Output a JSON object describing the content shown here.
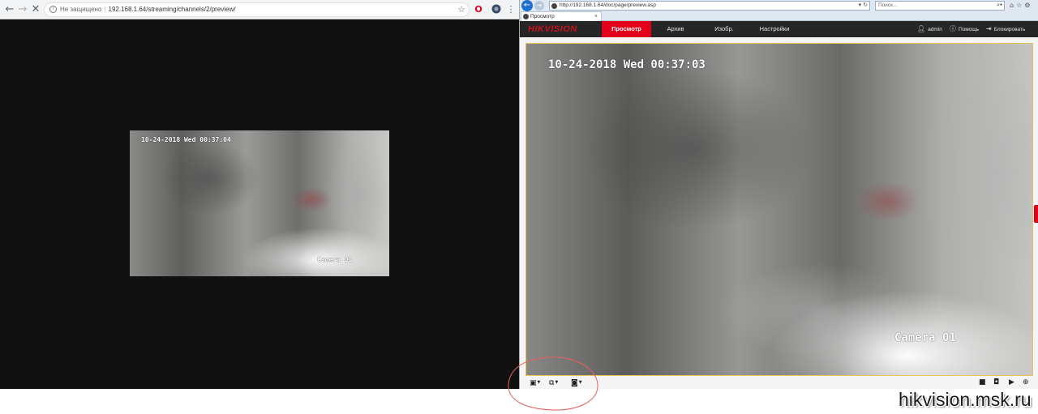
{
  "chrome": {
    "security_label": "Не защищено",
    "url": "192.168.1.64/streaming/channels/2/preview/",
    "back_icon": "arrow-left-icon",
    "forward_icon": "arrow-right-icon",
    "stop_icon": "close-icon"
  },
  "small_video": {
    "timestamp": "10-24-2018 Wed 00:37:04",
    "camera_name": "Camera 01"
  },
  "ie": {
    "url": "http://192.168.1.64/doc/page/preview.asp",
    "search_placeholder": "Поиск...",
    "tab_title": "Просмотр"
  },
  "hikvision": {
    "logo": "HIKVISION",
    "nav": [
      "Просмотр",
      "Архив",
      "Изобр.",
      "Настройки"
    ],
    "active_nav": "Просмотр",
    "user": "admin",
    "help": "Помощь",
    "lock": "Блокировать",
    "accent_color": "#e2001a"
  },
  "large_video": {
    "timestamp": "10-24-2018 Wed 00:37:03",
    "camera_name": "Camera 01"
  },
  "watermark": "hikvision.msk.ru"
}
